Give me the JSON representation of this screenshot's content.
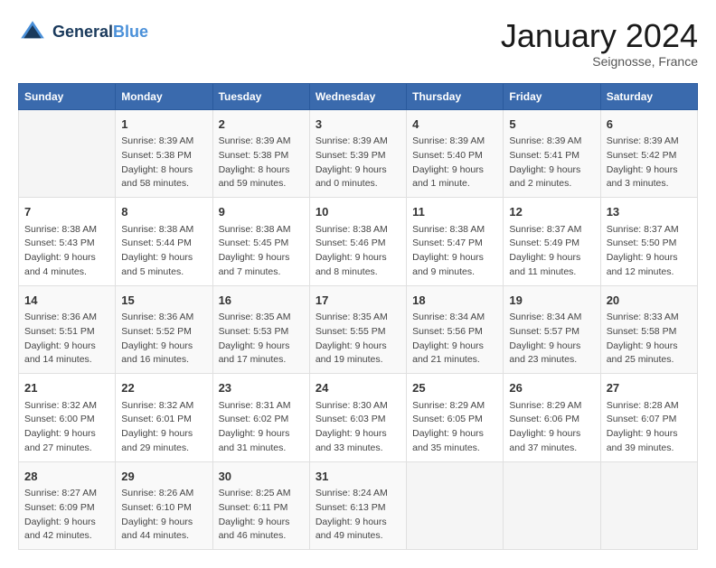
{
  "header": {
    "logo_line1": "General",
    "logo_line2": "Blue",
    "month_title": "January 2024",
    "location": "Seignosse, France"
  },
  "days_of_week": [
    "Sunday",
    "Monday",
    "Tuesday",
    "Wednesday",
    "Thursday",
    "Friday",
    "Saturday"
  ],
  "weeks": [
    [
      {
        "num": "",
        "sunrise": "",
        "sunset": "",
        "daylight": ""
      },
      {
        "num": "1",
        "sunrise": "Sunrise: 8:39 AM",
        "sunset": "Sunset: 5:38 PM",
        "daylight": "Daylight: 8 hours and 58 minutes."
      },
      {
        "num": "2",
        "sunrise": "Sunrise: 8:39 AM",
        "sunset": "Sunset: 5:38 PM",
        "daylight": "Daylight: 8 hours and 59 minutes."
      },
      {
        "num": "3",
        "sunrise": "Sunrise: 8:39 AM",
        "sunset": "Sunset: 5:39 PM",
        "daylight": "Daylight: 9 hours and 0 minutes."
      },
      {
        "num": "4",
        "sunrise": "Sunrise: 8:39 AM",
        "sunset": "Sunset: 5:40 PM",
        "daylight": "Daylight: 9 hours and 1 minute."
      },
      {
        "num": "5",
        "sunrise": "Sunrise: 8:39 AM",
        "sunset": "Sunset: 5:41 PM",
        "daylight": "Daylight: 9 hours and 2 minutes."
      },
      {
        "num": "6",
        "sunrise": "Sunrise: 8:39 AM",
        "sunset": "Sunset: 5:42 PM",
        "daylight": "Daylight: 9 hours and 3 minutes."
      }
    ],
    [
      {
        "num": "7",
        "sunrise": "Sunrise: 8:38 AM",
        "sunset": "Sunset: 5:43 PM",
        "daylight": "Daylight: 9 hours and 4 minutes."
      },
      {
        "num": "8",
        "sunrise": "Sunrise: 8:38 AM",
        "sunset": "Sunset: 5:44 PM",
        "daylight": "Daylight: 9 hours and 5 minutes."
      },
      {
        "num": "9",
        "sunrise": "Sunrise: 8:38 AM",
        "sunset": "Sunset: 5:45 PM",
        "daylight": "Daylight: 9 hours and 7 minutes."
      },
      {
        "num": "10",
        "sunrise": "Sunrise: 8:38 AM",
        "sunset": "Sunset: 5:46 PM",
        "daylight": "Daylight: 9 hours and 8 minutes."
      },
      {
        "num": "11",
        "sunrise": "Sunrise: 8:38 AM",
        "sunset": "Sunset: 5:47 PM",
        "daylight": "Daylight: 9 hours and 9 minutes."
      },
      {
        "num": "12",
        "sunrise": "Sunrise: 8:37 AM",
        "sunset": "Sunset: 5:49 PM",
        "daylight": "Daylight: 9 hours and 11 minutes."
      },
      {
        "num": "13",
        "sunrise": "Sunrise: 8:37 AM",
        "sunset": "Sunset: 5:50 PM",
        "daylight": "Daylight: 9 hours and 12 minutes."
      }
    ],
    [
      {
        "num": "14",
        "sunrise": "Sunrise: 8:36 AM",
        "sunset": "Sunset: 5:51 PM",
        "daylight": "Daylight: 9 hours and 14 minutes."
      },
      {
        "num": "15",
        "sunrise": "Sunrise: 8:36 AM",
        "sunset": "Sunset: 5:52 PM",
        "daylight": "Daylight: 9 hours and 16 minutes."
      },
      {
        "num": "16",
        "sunrise": "Sunrise: 8:35 AM",
        "sunset": "Sunset: 5:53 PM",
        "daylight": "Daylight: 9 hours and 17 minutes."
      },
      {
        "num": "17",
        "sunrise": "Sunrise: 8:35 AM",
        "sunset": "Sunset: 5:55 PM",
        "daylight": "Daylight: 9 hours and 19 minutes."
      },
      {
        "num": "18",
        "sunrise": "Sunrise: 8:34 AM",
        "sunset": "Sunset: 5:56 PM",
        "daylight": "Daylight: 9 hours and 21 minutes."
      },
      {
        "num": "19",
        "sunrise": "Sunrise: 8:34 AM",
        "sunset": "Sunset: 5:57 PM",
        "daylight": "Daylight: 9 hours and 23 minutes."
      },
      {
        "num": "20",
        "sunrise": "Sunrise: 8:33 AM",
        "sunset": "Sunset: 5:58 PM",
        "daylight": "Daylight: 9 hours and 25 minutes."
      }
    ],
    [
      {
        "num": "21",
        "sunrise": "Sunrise: 8:32 AM",
        "sunset": "Sunset: 6:00 PM",
        "daylight": "Daylight: 9 hours and 27 minutes."
      },
      {
        "num": "22",
        "sunrise": "Sunrise: 8:32 AM",
        "sunset": "Sunset: 6:01 PM",
        "daylight": "Daylight: 9 hours and 29 minutes."
      },
      {
        "num": "23",
        "sunrise": "Sunrise: 8:31 AM",
        "sunset": "Sunset: 6:02 PM",
        "daylight": "Daylight: 9 hours and 31 minutes."
      },
      {
        "num": "24",
        "sunrise": "Sunrise: 8:30 AM",
        "sunset": "Sunset: 6:03 PM",
        "daylight": "Daylight: 9 hours and 33 minutes."
      },
      {
        "num": "25",
        "sunrise": "Sunrise: 8:29 AM",
        "sunset": "Sunset: 6:05 PM",
        "daylight": "Daylight: 9 hours and 35 minutes."
      },
      {
        "num": "26",
        "sunrise": "Sunrise: 8:29 AM",
        "sunset": "Sunset: 6:06 PM",
        "daylight": "Daylight: 9 hours and 37 minutes."
      },
      {
        "num": "27",
        "sunrise": "Sunrise: 8:28 AM",
        "sunset": "Sunset: 6:07 PM",
        "daylight": "Daylight: 9 hours and 39 minutes."
      }
    ],
    [
      {
        "num": "28",
        "sunrise": "Sunrise: 8:27 AM",
        "sunset": "Sunset: 6:09 PM",
        "daylight": "Daylight: 9 hours and 42 minutes."
      },
      {
        "num": "29",
        "sunrise": "Sunrise: 8:26 AM",
        "sunset": "Sunset: 6:10 PM",
        "daylight": "Daylight: 9 hours and 44 minutes."
      },
      {
        "num": "30",
        "sunrise": "Sunrise: 8:25 AM",
        "sunset": "Sunset: 6:11 PM",
        "daylight": "Daylight: 9 hours and 46 minutes."
      },
      {
        "num": "31",
        "sunrise": "Sunrise: 8:24 AM",
        "sunset": "Sunset: 6:13 PM",
        "daylight": "Daylight: 9 hours and 49 minutes."
      },
      {
        "num": "",
        "sunrise": "",
        "sunset": "",
        "daylight": ""
      },
      {
        "num": "",
        "sunrise": "",
        "sunset": "",
        "daylight": ""
      },
      {
        "num": "",
        "sunrise": "",
        "sunset": "",
        "daylight": ""
      }
    ]
  ]
}
